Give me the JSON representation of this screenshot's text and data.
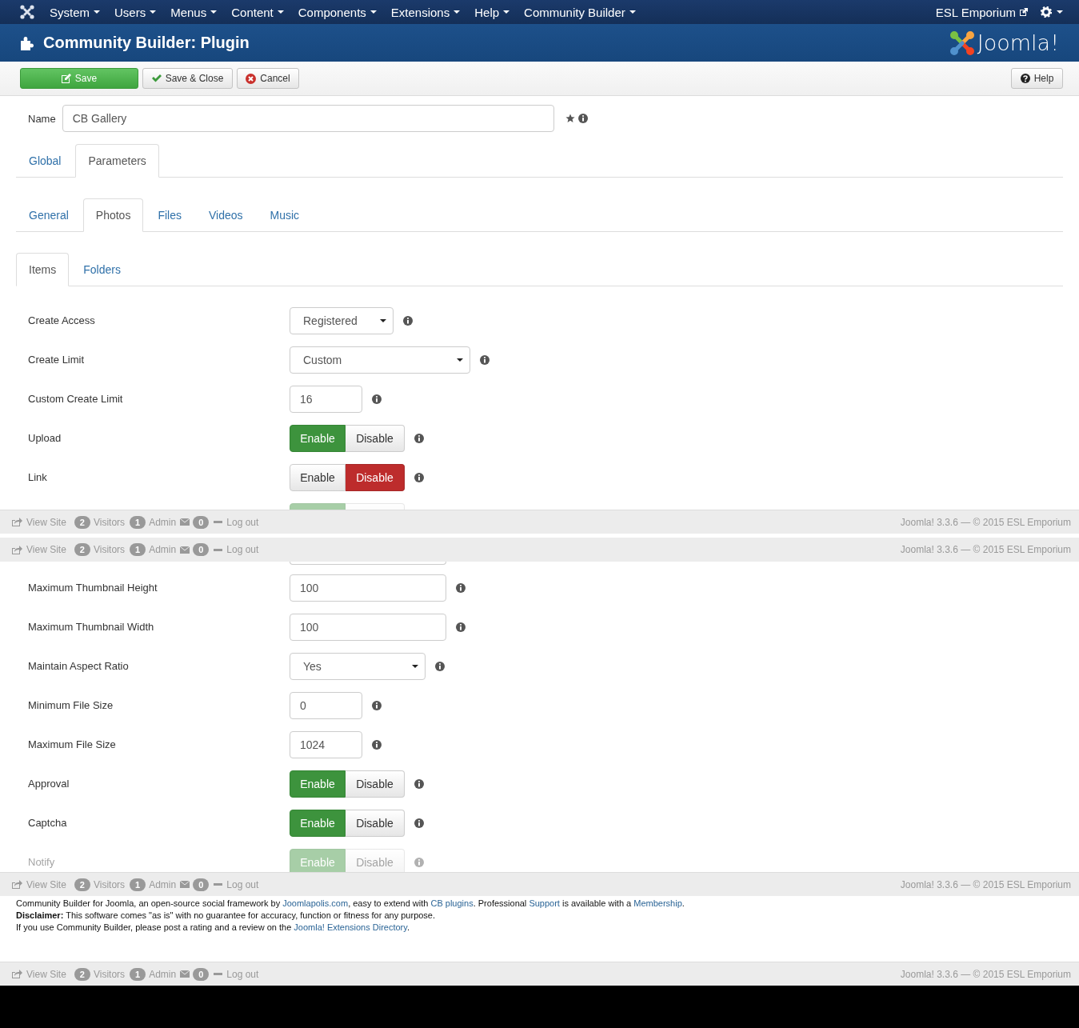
{
  "top_menu": {
    "items": [
      {
        "label": "System"
      },
      {
        "label": "Users"
      },
      {
        "label": "Menus"
      },
      {
        "label": "Content"
      },
      {
        "label": "Components"
      },
      {
        "label": "Extensions"
      },
      {
        "label": "Help"
      },
      {
        "label": "Community Builder"
      }
    ],
    "site_link": "ESL Emporium"
  },
  "title_bar": {
    "title": "Community Builder: Plugin",
    "logo": "Joomla!"
  },
  "toolbar": {
    "buttons": [
      {
        "label": "Save",
        "kind": "save"
      },
      {
        "label": "Save & Close",
        "kind": "save-close"
      },
      {
        "label": "Cancel",
        "kind": "cancel"
      }
    ],
    "help": "Help"
  },
  "sections": [
    {
      "kind": "panel",
      "name_field": {
        "label": "Name",
        "value": "CB Gallery"
      },
      "tab_groups": [
        {
          "tabs": [
            {
              "label": "Global",
              "selected": false
            },
            {
              "label": "Parameters",
              "selected": true
            }
          ]
        },
        {
          "tabs": [
            {
              "label": "General",
              "selected": false
            },
            {
              "label": "Photos",
              "selected": true
            },
            {
              "label": "Files",
              "selected": false
            },
            {
              "label": "Videos",
              "selected": false
            },
            {
              "label": "Music",
              "selected": false
            }
          ]
        },
        {
          "tabs": [
            {
              "label": "Items",
              "selected": true
            },
            {
              "label": "Folders",
              "selected": false
            }
          ]
        }
      ],
      "rows": [
        {
          "kind": "select",
          "label": "Create Access",
          "value": "Registered",
          "dimmed": false
        },
        {
          "kind": "select",
          "label": "Create Limit",
          "value": "Custom",
          "dimmed": false
        },
        {
          "kind": "input",
          "label": "Custom Create Limit",
          "value": "16",
          "dimmed": false
        },
        {
          "kind": "toggle",
          "label": "Upload",
          "options": [
            {
              "label": "Enable",
              "selected": true
            },
            {
              "label": "Disable",
              "selected": false
            }
          ],
          "dimmed": false
        },
        {
          "kind": "toggle",
          "label": "Link",
          "options": [
            {
              "label": "Enable",
              "selected": false
            },
            {
              "label": "Disable",
              "selected": true
            }
          ],
          "dimmed": false
        },
        {
          "kind": "toggle-cut",
          "options": [
            {
              "selected": true
            },
            {
              "selected": false
            }
          ],
          "dimmed": true
        }
      ]
    },
    {
      "kind": "status_bar",
      "view_site": "View Site",
      "visitors_count": "2",
      "visitors": "Visitors",
      "admin_count": "1",
      "admin": "Admin",
      "messages_count": "0",
      "logout": "Log out",
      "version": "Joomla! 3.3.6 — © 2015 ESL Emporium"
    },
    {
      "kind": "status_bar",
      "view_site": "View Site",
      "visitors_count": "2",
      "visitors": "Visitors",
      "admin_count": "1",
      "admin": "Admin",
      "messages_count": "0",
      "logout": "Log out",
      "version": "Joomla! 3.3.6 — © 2015 ESL Emporium"
    },
    {
      "kind": "panel",
      "rows": [
        {
          "kind": "input-cut",
          "dimmed": false
        },
        {
          "kind": "input",
          "label": "Maximum Thumbnail Height",
          "value": "100",
          "dimmed": false
        },
        {
          "kind": "input",
          "label": "Maximum Thumbnail Width",
          "value": "100",
          "dimmed": false
        },
        {
          "kind": "select",
          "label": "Maintain Aspect Ratio",
          "value": "Yes",
          "dimmed": false
        },
        {
          "kind": "input",
          "label": "Minimum File Size",
          "value": "0",
          "dimmed": false
        },
        {
          "kind": "input",
          "label": "Maximum File Size",
          "value": "1024",
          "dimmed": false
        },
        {
          "kind": "toggle",
          "label": "Approval",
          "options": [
            {
              "label": "Enable",
              "selected": true
            },
            {
              "label": "Disable",
              "selected": false
            }
          ],
          "dimmed": false
        },
        {
          "kind": "toggle",
          "label": "Captcha",
          "options": [
            {
              "label": "Enable",
              "selected": true
            },
            {
              "label": "Disable",
              "selected": false
            }
          ],
          "dimmed": false
        },
        {
          "kind": "toggle",
          "label": "Notify",
          "options": [
            {
              "label": "Enable",
              "selected": true
            },
            {
              "label": "Disable",
              "selected": false
            }
          ],
          "dimmed": true
        }
      ]
    },
    {
      "kind": "status_bar",
      "view_site": "View Site",
      "visitors_count": "2",
      "visitors": "Visitors",
      "admin_count": "1",
      "admin": "Admin",
      "messages_count": "0",
      "logout": "Log out",
      "version": "Joomla! 3.3.6 — © 2015 ESL Emporium"
    },
    {
      "kind": "credits",
      "lines": [
        [
          {
            "text": "Community Builder for Joomla, an open-source social framework by ",
            "kind": "text"
          },
          {
            "text": "Joomlapolis.com",
            "kind": "link"
          },
          {
            "text": ", easy to extend with ",
            "kind": "text"
          },
          {
            "text": "CB plugins",
            "kind": "link"
          },
          {
            "text": ". Professional ",
            "kind": "text"
          },
          {
            "text": "Support",
            "kind": "link"
          },
          {
            "text": " is available with a ",
            "kind": "text"
          },
          {
            "text": "Membership",
            "kind": "link"
          },
          {
            "text": ".",
            "kind": "text"
          }
        ],
        [
          {
            "text": "**Disclaimer:** This software comes \"as is\" with no guarantee for accuracy, function or fitness for any purpose.",
            "kind": "text"
          }
        ],
        [
          {
            "text": "If you use Community Builder, please post a rating and a review on the ",
            "kind": "text"
          },
          {
            "text": "Joomla! Extensions Directory",
            "kind": "link"
          },
          {
            "text": ".",
            "kind": "text"
          }
        ]
      ]
    },
    {
      "kind": "status_bar",
      "view_site": "View Site",
      "visitors_count": "2",
      "visitors": "Visitors",
      "admin_count": "1",
      "admin": "Admin",
      "messages_count": "0",
      "logout": "Log out",
      "version": "Joomla! 3.3.6 — © 2015 ESL Emporium"
    }
  ]
}
